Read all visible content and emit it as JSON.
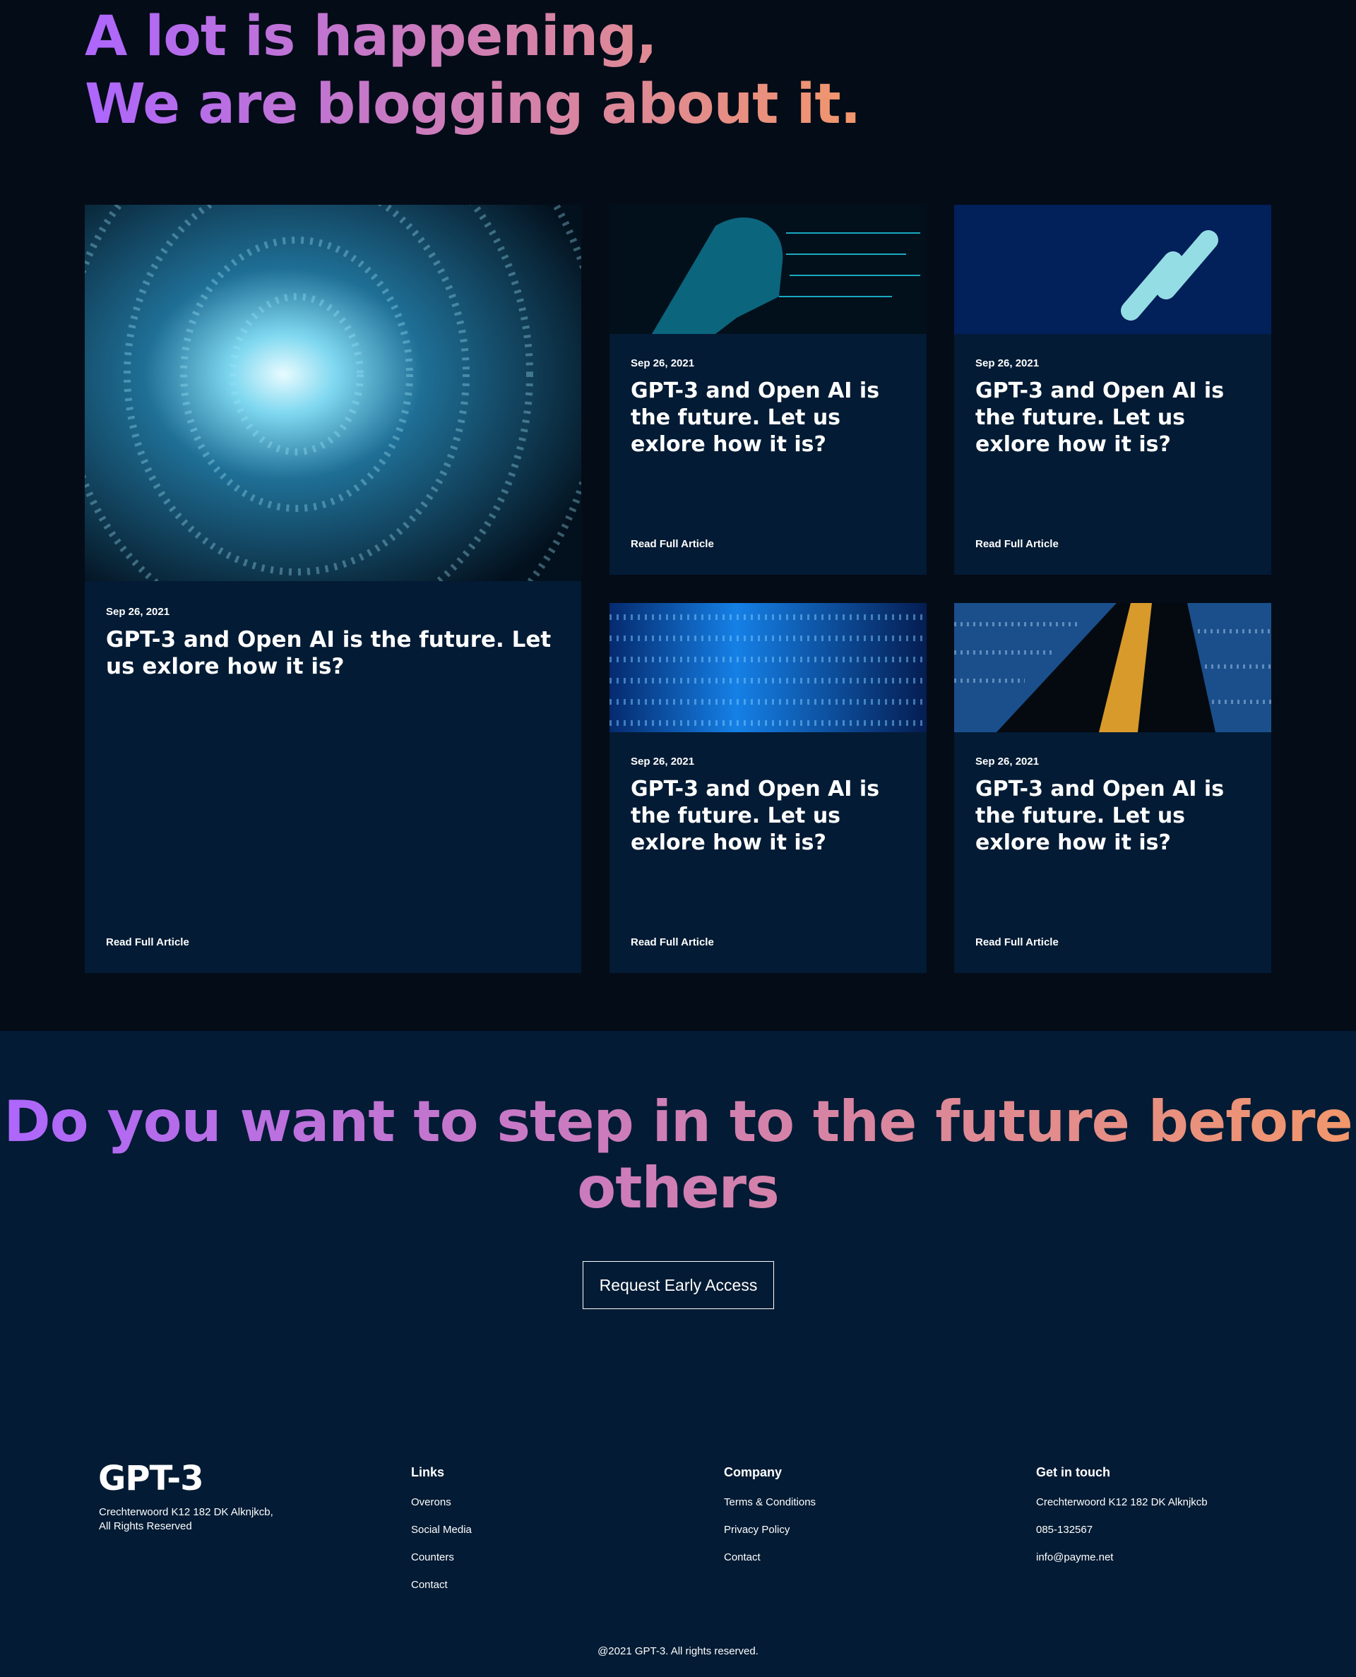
{
  "blog": {
    "heading_line1": "A lot is happening,",
    "heading_line2": "We are blogging about it.",
    "articles": [
      {
        "date": "Sep 26, 2021",
        "title": "GPT-3 and Open AI is the future. Let us exlore how it is?",
        "link": "Read Full Article",
        "image": "binary-tunnel"
      },
      {
        "date": "Sep 26, 2021",
        "title": "GPT-3 and Open AI is the future. Let us exlore how it is?",
        "link": "Read Full Article",
        "image": "ai-face-circuit"
      },
      {
        "date": "Sep 26, 2021",
        "title": "GPT-3 and Open AI is the future. Let us exlore how it is?",
        "link": "Read Full Article",
        "image": "chain-link-binary"
      },
      {
        "date": "Sep 26, 2021",
        "title": "GPT-3 and Open AI is the future. Let us exlore how it is?",
        "link": "Read Full Article",
        "image": "blue-binary-grid"
      },
      {
        "date": "Sep 26, 2021",
        "title": "GPT-3 and Open AI is the future. Let us exlore how it is?",
        "link": "Read Full Article",
        "image": "binary-perspective-gold"
      }
    ]
  },
  "cta": {
    "heading": "Do you want to step in to the future before others",
    "button": "Request Early Access"
  },
  "footer": {
    "logo": "GPT-3",
    "address_line1": "Crechterwoord K12 182 DK Alknjkcb,",
    "address_line2": "All Rights Reserved",
    "links": {
      "title": "Links",
      "items": [
        "Overons",
        "Social Media",
        "Counters",
        "Contact"
      ]
    },
    "company": {
      "title": "Company",
      "items": [
        "Terms & Conditions",
        "Privacy Policy",
        "Contact"
      ]
    },
    "contact": {
      "title": "Get in touch",
      "items": [
        "Crechterwoord K12 182 DK Alknjkcb",
        "085-132567",
        "info@payme.net"
      ]
    },
    "copyright": "@2021 GPT-3. All rights reserved."
  },
  "colors": {
    "background": "#040c18",
    "section": "#031b34",
    "gradient_start": "#ae67fa",
    "gradient_end": "#f49867"
  }
}
